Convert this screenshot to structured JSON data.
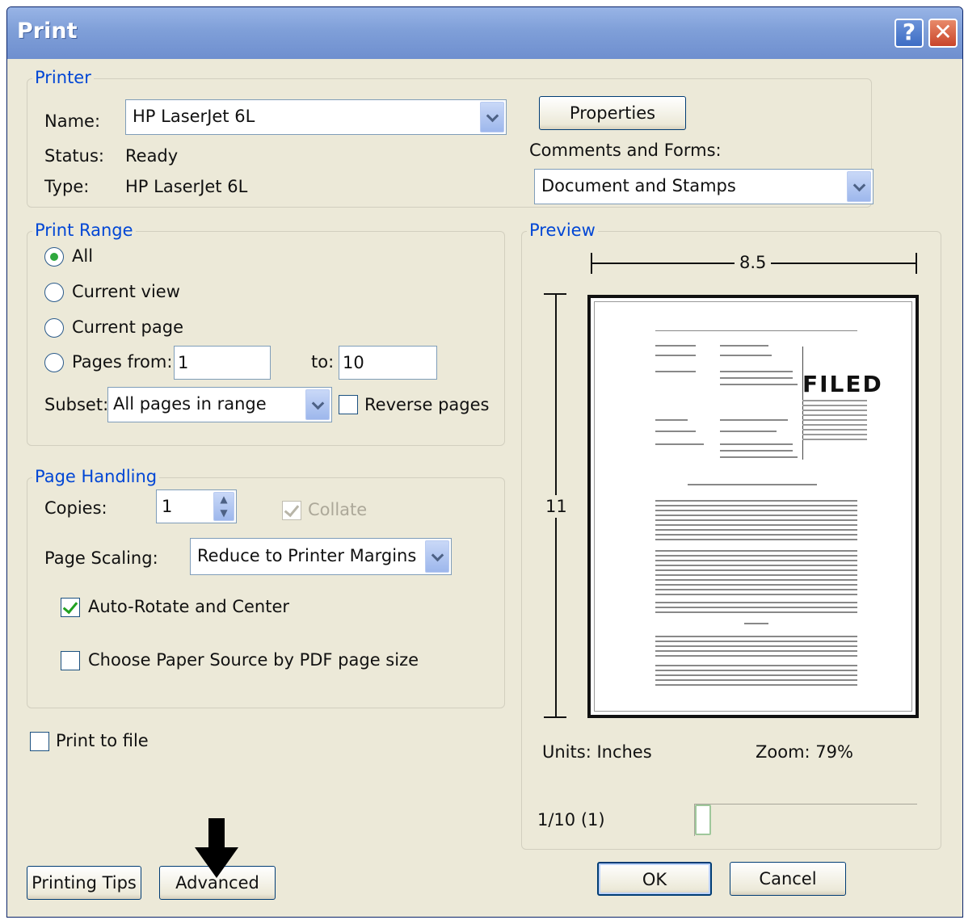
{
  "window": {
    "title": "Print"
  },
  "titlebar": {
    "help_glyph": "?",
    "close_glyph": "✕"
  },
  "printer": {
    "legend": "Printer",
    "name_label": "Name:",
    "name_value": "HP LaserJet 6L",
    "status_label": "Status:",
    "status_value": "Ready",
    "type_label": "Type:",
    "type_value": "HP LaserJet 6L",
    "properties_button": "Properties",
    "comments_label": "Comments and Forms:",
    "comments_value": "Document and Stamps"
  },
  "print_range": {
    "legend": "Print Range",
    "all": "All",
    "current_view": "Current view",
    "current_page": "Current page",
    "pages_from": "Pages from:",
    "from_value": "1",
    "to_label": "to:",
    "to_value": "10",
    "subset_label": "Subset:",
    "subset_value": "All pages in range",
    "reverse_pages": "Reverse pages",
    "selected": "all"
  },
  "page_handling": {
    "legend": "Page Handling",
    "copies_label": "Copies:",
    "copies_value": "1",
    "collate": "Collate",
    "scaling_label": "Page Scaling:",
    "scaling_value": "Reduce to Printer Margins",
    "auto_rotate": "Auto-Rotate and Center",
    "paper_source": "Choose Paper Source by PDF page size"
  },
  "print_to_file": "Print to file",
  "preview": {
    "legend": "Preview",
    "width": "8.5",
    "height": "11",
    "stamp": "FILED",
    "units": "Units: Inches",
    "zoom": "Zoom:  79%",
    "page_indicator": "1/10 (1)"
  },
  "buttons": {
    "printing_tips": "Printing Tips",
    "advanced": "Advanced",
    "ok": "OK",
    "cancel": "Cancel"
  },
  "colors": {
    "accent": "#0046d5",
    "title_bar": "#7f9fd8",
    "dialog_bg": "#ece9d8"
  }
}
